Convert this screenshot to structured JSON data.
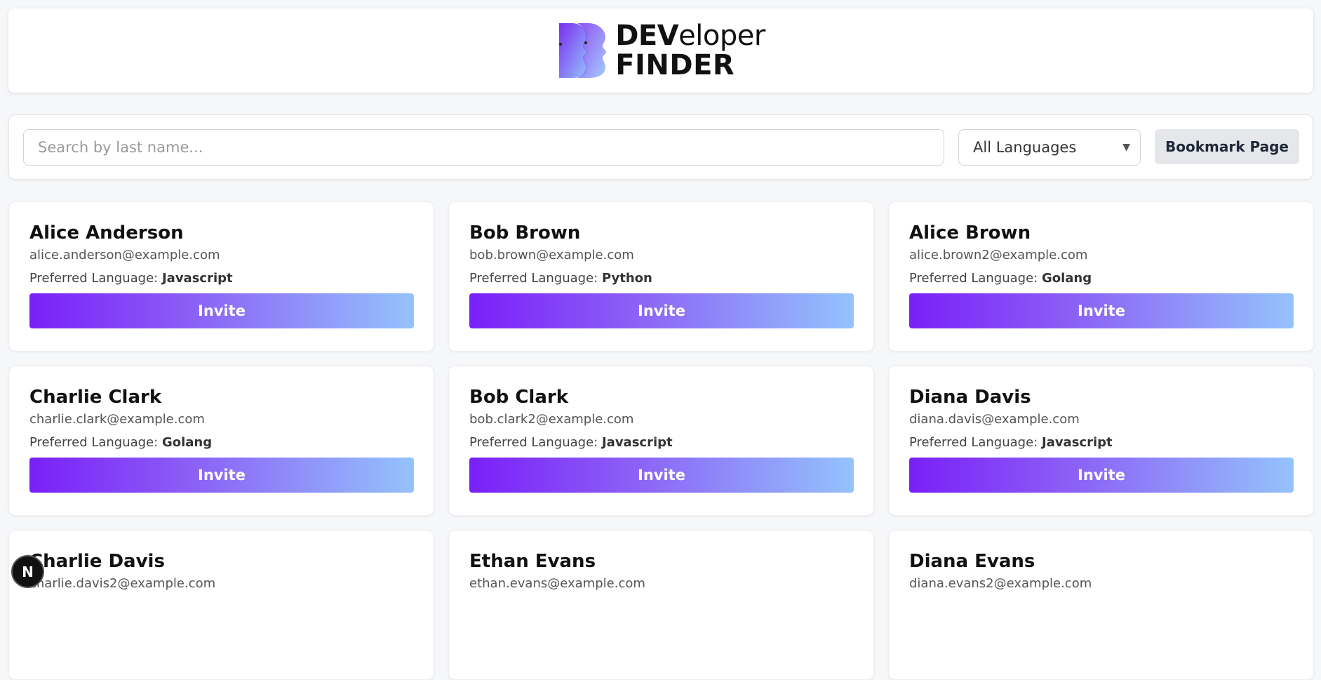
{
  "header": {
    "logo_dev": "DEV",
    "logo_eloper": "eloper",
    "logo_finder": "FINDER"
  },
  "toolbar": {
    "search_placeholder": "Search by last name...",
    "language_selected": "All Languages",
    "bookmark_label": "Bookmark Page"
  },
  "developers": [
    {
      "name": "Alice Anderson",
      "email": "alice.anderson@example.com",
      "lang_label": "Preferred Language:",
      "language": "Javascript",
      "invite": "Invite"
    },
    {
      "name": "Bob Brown",
      "email": "bob.brown@example.com",
      "lang_label": "Preferred Language:",
      "language": "Python",
      "invite": "Invite"
    },
    {
      "name": "Alice Brown",
      "email": "alice.brown2@example.com",
      "lang_label": "Preferred Language:",
      "language": "Golang",
      "invite": "Invite"
    },
    {
      "name": "Charlie Clark",
      "email": "charlie.clark@example.com",
      "lang_label": "Preferred Language:",
      "language": "Golang",
      "invite": "Invite"
    },
    {
      "name": "Bob Clark",
      "email": "bob.clark2@example.com",
      "lang_label": "Preferred Language:",
      "language": "Javascript",
      "invite": "Invite"
    },
    {
      "name": "Diana Davis",
      "email": "diana.davis@example.com",
      "lang_label": "Preferred Language:",
      "language": "Javascript",
      "invite": "Invite"
    },
    {
      "name": "Charlie Davis",
      "email": "charlie.davis2@example.com"
    },
    {
      "name": "Ethan Evans",
      "email": "ethan.evans@example.com"
    },
    {
      "name": "Diana Evans",
      "email": "diana.evans2@example.com"
    }
  ],
  "badge": {
    "letter": "N"
  },
  "colors": {
    "accent_start": "#7a1ff8",
    "accent_end": "#94c3fc",
    "background": "#f6f7f9"
  }
}
